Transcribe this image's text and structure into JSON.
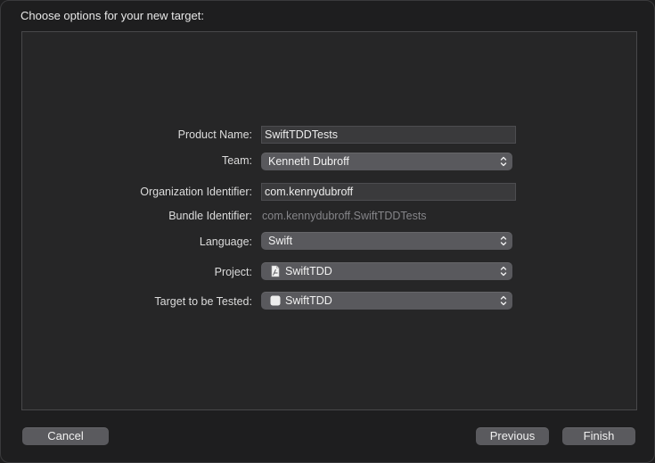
{
  "dialog": {
    "title": "Choose options for your new target:"
  },
  "form": {
    "product_name": {
      "label": "Product Name:",
      "value": "SwiftTDDTests"
    },
    "team": {
      "label": "Team:",
      "value": "Kenneth Dubroff"
    },
    "organization_identifier": {
      "label": "Organization Identifier:",
      "value": "com.kennydubroff"
    },
    "bundle_identifier": {
      "label": "Bundle Identifier:",
      "value": "com.kennydubroff.SwiftTDDTests"
    },
    "language": {
      "label": "Language:",
      "value": "Swift"
    },
    "project": {
      "label": "Project:",
      "value": "SwiftTDD",
      "icon": "project-file-icon"
    },
    "target_to_be_tested": {
      "label": "Target to be Tested:",
      "value": "SwiftTDD",
      "icon": "app-target-icon"
    }
  },
  "buttons": {
    "cancel": "Cancel",
    "previous": "Previous",
    "finish": "Finish"
  }
}
